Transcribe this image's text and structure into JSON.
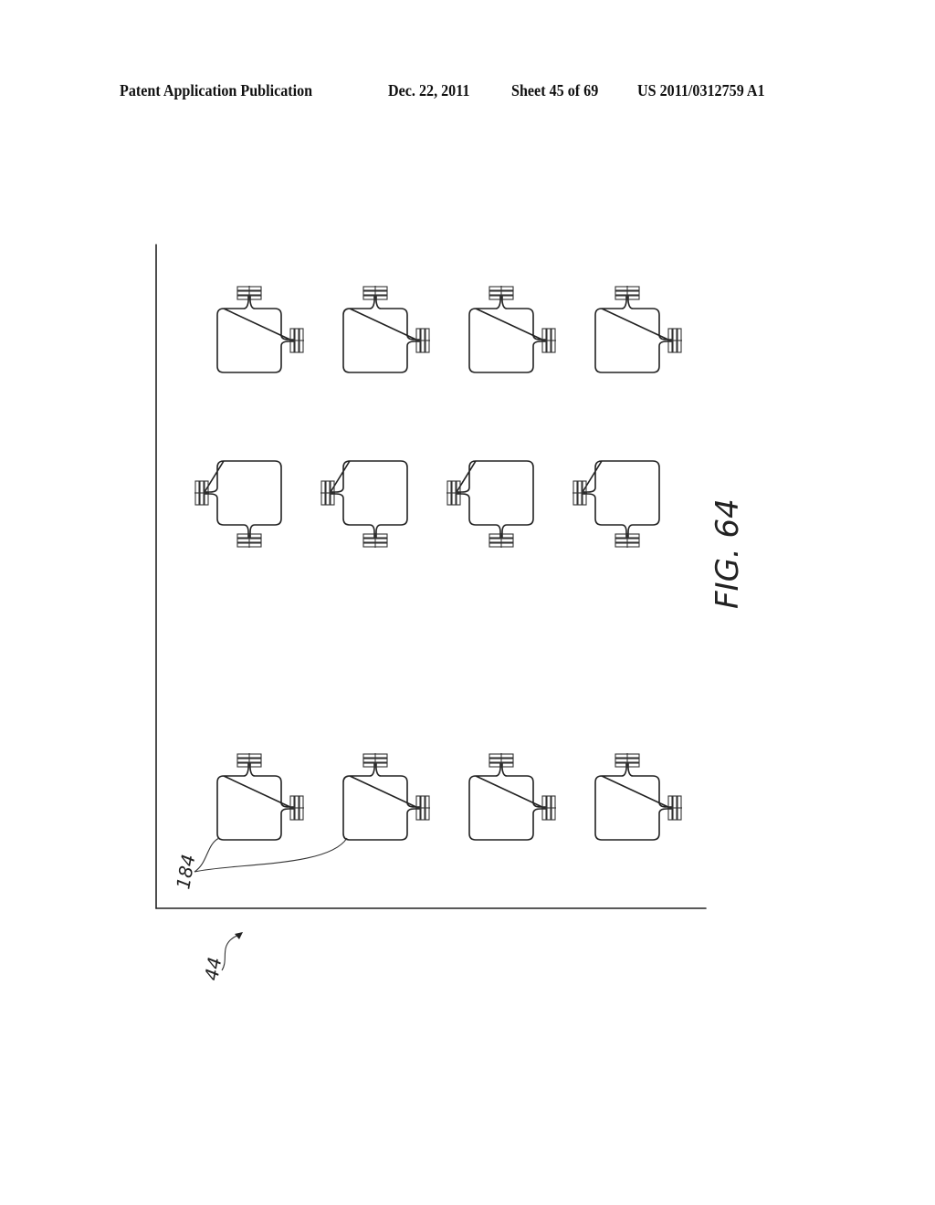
{
  "header": {
    "publication": "Patent Application Publication",
    "date": "Dec. 22, 2011",
    "sheet": "Sheet 45 of 69",
    "number": "US 2011/0312759 A1"
  },
  "figure": {
    "caption": "FIG. 64",
    "reference_labels": {
      "element": "184",
      "substrate": "44"
    },
    "rows": [
      {
        "name": "top-row",
        "orientation": "pads-top-right",
        "count": 4
      },
      {
        "name": "middle-row",
        "orientation": "pads-left-bottom",
        "count": 4
      },
      {
        "name": "bottom-row",
        "orientation": "pads-top-right",
        "count": 4
      }
    ]
  }
}
